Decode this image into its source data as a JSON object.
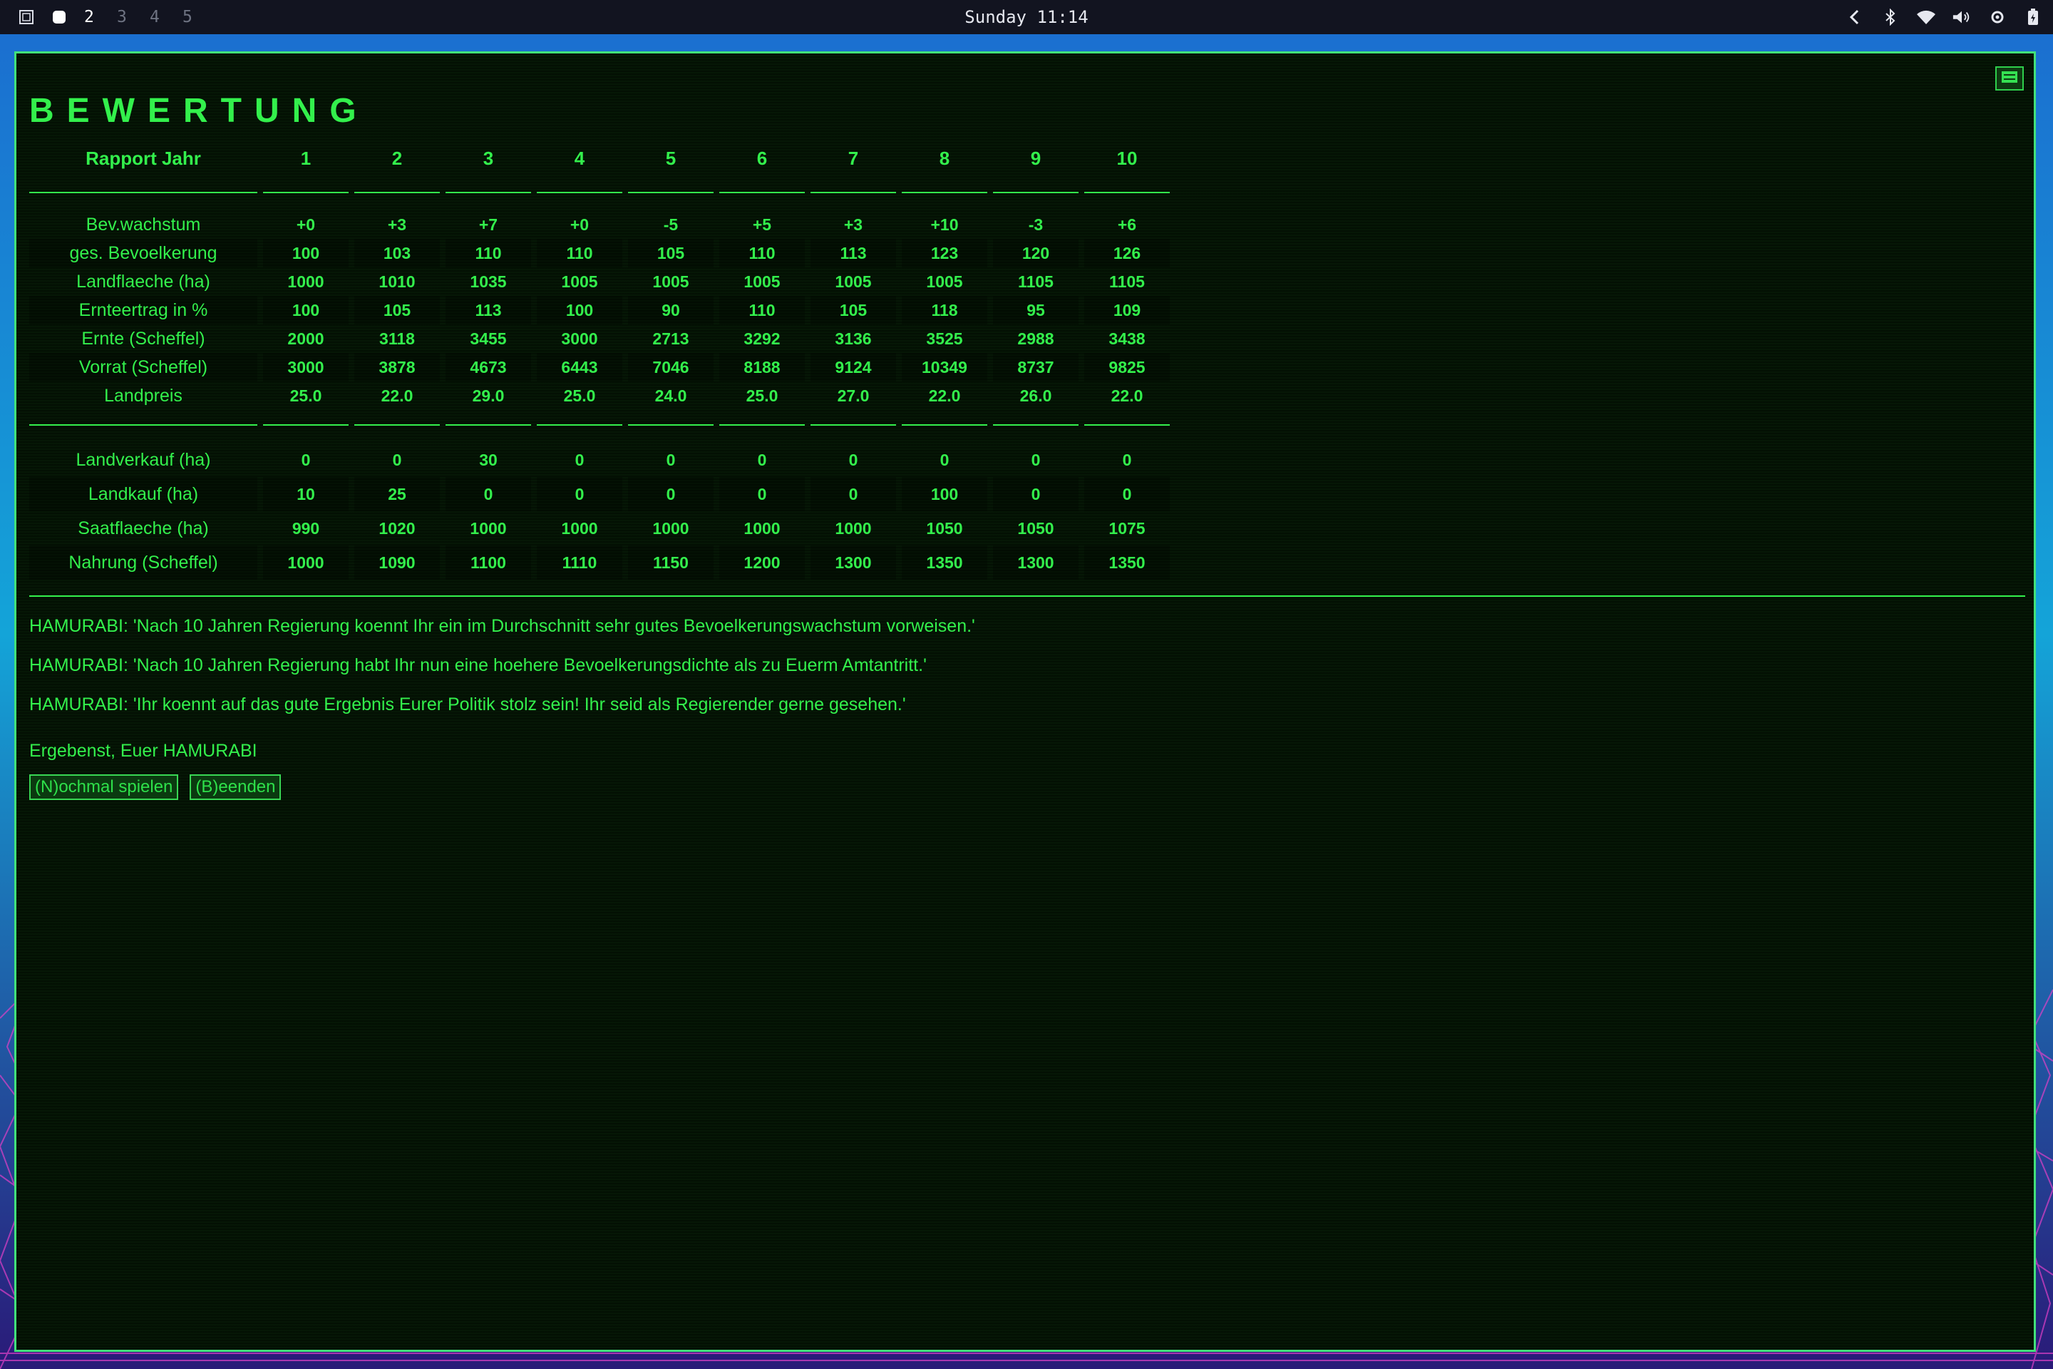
{
  "top_bar": {
    "workspaces": [
      "2",
      "3",
      "4",
      "5"
    ],
    "active_workspace": "2",
    "clock": "Sunday  11:14"
  },
  "window": {
    "title": "BEWERTUNG",
    "table": {
      "header_label": "Rapport Jahr",
      "years": [
        "1",
        "2",
        "3",
        "4",
        "5",
        "6",
        "7",
        "8",
        "9",
        "10"
      ],
      "section1": [
        {
          "label": "Bev.wachstum",
          "values": [
            "+0",
            "+3",
            "+7",
            "+0",
            "-5",
            "+5",
            "+3",
            "+10",
            "-3",
            "+6"
          ]
        },
        {
          "label": "ges. Bevoelkerung",
          "values": [
            "100",
            "103",
            "110",
            "110",
            "105",
            "110",
            "113",
            "123",
            "120",
            "126"
          ]
        },
        {
          "label": "Landflaeche (ha)",
          "values": [
            "1000",
            "1010",
            "1035",
            "1005",
            "1005",
            "1005",
            "1005",
            "1005",
            "1105",
            "1105"
          ]
        },
        {
          "label": "Ernteertrag in %",
          "values": [
            "100",
            "105",
            "113",
            "100",
            "90",
            "110",
            "105",
            "118",
            "95",
            "109"
          ]
        },
        {
          "label": "Ernte (Scheffel)",
          "values": [
            "2000",
            "3118",
            "3455",
            "3000",
            "2713",
            "3292",
            "3136",
            "3525",
            "2988",
            "3438"
          ]
        },
        {
          "label": "Vorrat (Scheffel)",
          "values": [
            "3000",
            "3878",
            "4673",
            "6443",
            "7046",
            "8188",
            "9124",
            "10349",
            "8737",
            "9825"
          ]
        },
        {
          "label": "Landpreis",
          "values": [
            "25.0",
            "22.0",
            "29.0",
            "25.0",
            "24.0",
            "25.0",
            "27.0",
            "22.0",
            "26.0",
            "22.0"
          ]
        }
      ],
      "section2": [
        {
          "label": "Landverkauf (ha)",
          "values": [
            "0",
            "0",
            "30",
            "0",
            "0",
            "0",
            "0",
            "0",
            "0",
            "0"
          ]
        },
        {
          "label": "Landkauf (ha)",
          "values": [
            "10",
            "25",
            "0",
            "0",
            "0",
            "0",
            "0",
            "100",
            "0",
            "0"
          ]
        },
        {
          "label": "Saatflaeche (ha)",
          "values": [
            "990",
            "1020",
            "1000",
            "1000",
            "1000",
            "1000",
            "1000",
            "1050",
            "1050",
            "1075"
          ]
        },
        {
          "label": "Nahrung (Scheffel)",
          "values": [
            "1000",
            "1090",
            "1100",
            "1110",
            "1150",
            "1200",
            "1300",
            "1350",
            "1300",
            "1350"
          ]
        }
      ]
    },
    "messages": [
      "HAMURABI: 'Nach 10 Jahren Regierung koennt Ihr ein im Durchschnitt sehr gutes Bevoelkerungswachstum vorweisen.'",
      "HAMURABI: 'Nach 10 Jahren Regierung habt Ihr nun eine hoehere Bevoelkerungsdichte als zu Euerm Amtantritt.'",
      "HAMURABI: 'Ihr koennt auf das gute Ergebnis Eurer Politik stolz sein! Ihr seid als Regierender gerne gesehen.'"
    ],
    "signature": "Ergebenst, Euer HAMURABI",
    "buttons": {
      "play_again": "(N)ochmal spielen",
      "quit": "(B)eenden"
    }
  },
  "colors": {
    "terminal_green": "#33f04c",
    "window_background": "#041404",
    "window_border": "#42e07a",
    "panel_background": "#121420"
  },
  "icons": [
    "window-switcher-icon",
    "workspace-dot-icon",
    "chevron-left-icon",
    "bluetooth-icon",
    "wifi-icon",
    "volume-icon",
    "settings-icon",
    "battery-icon",
    "menu-icon"
  ]
}
